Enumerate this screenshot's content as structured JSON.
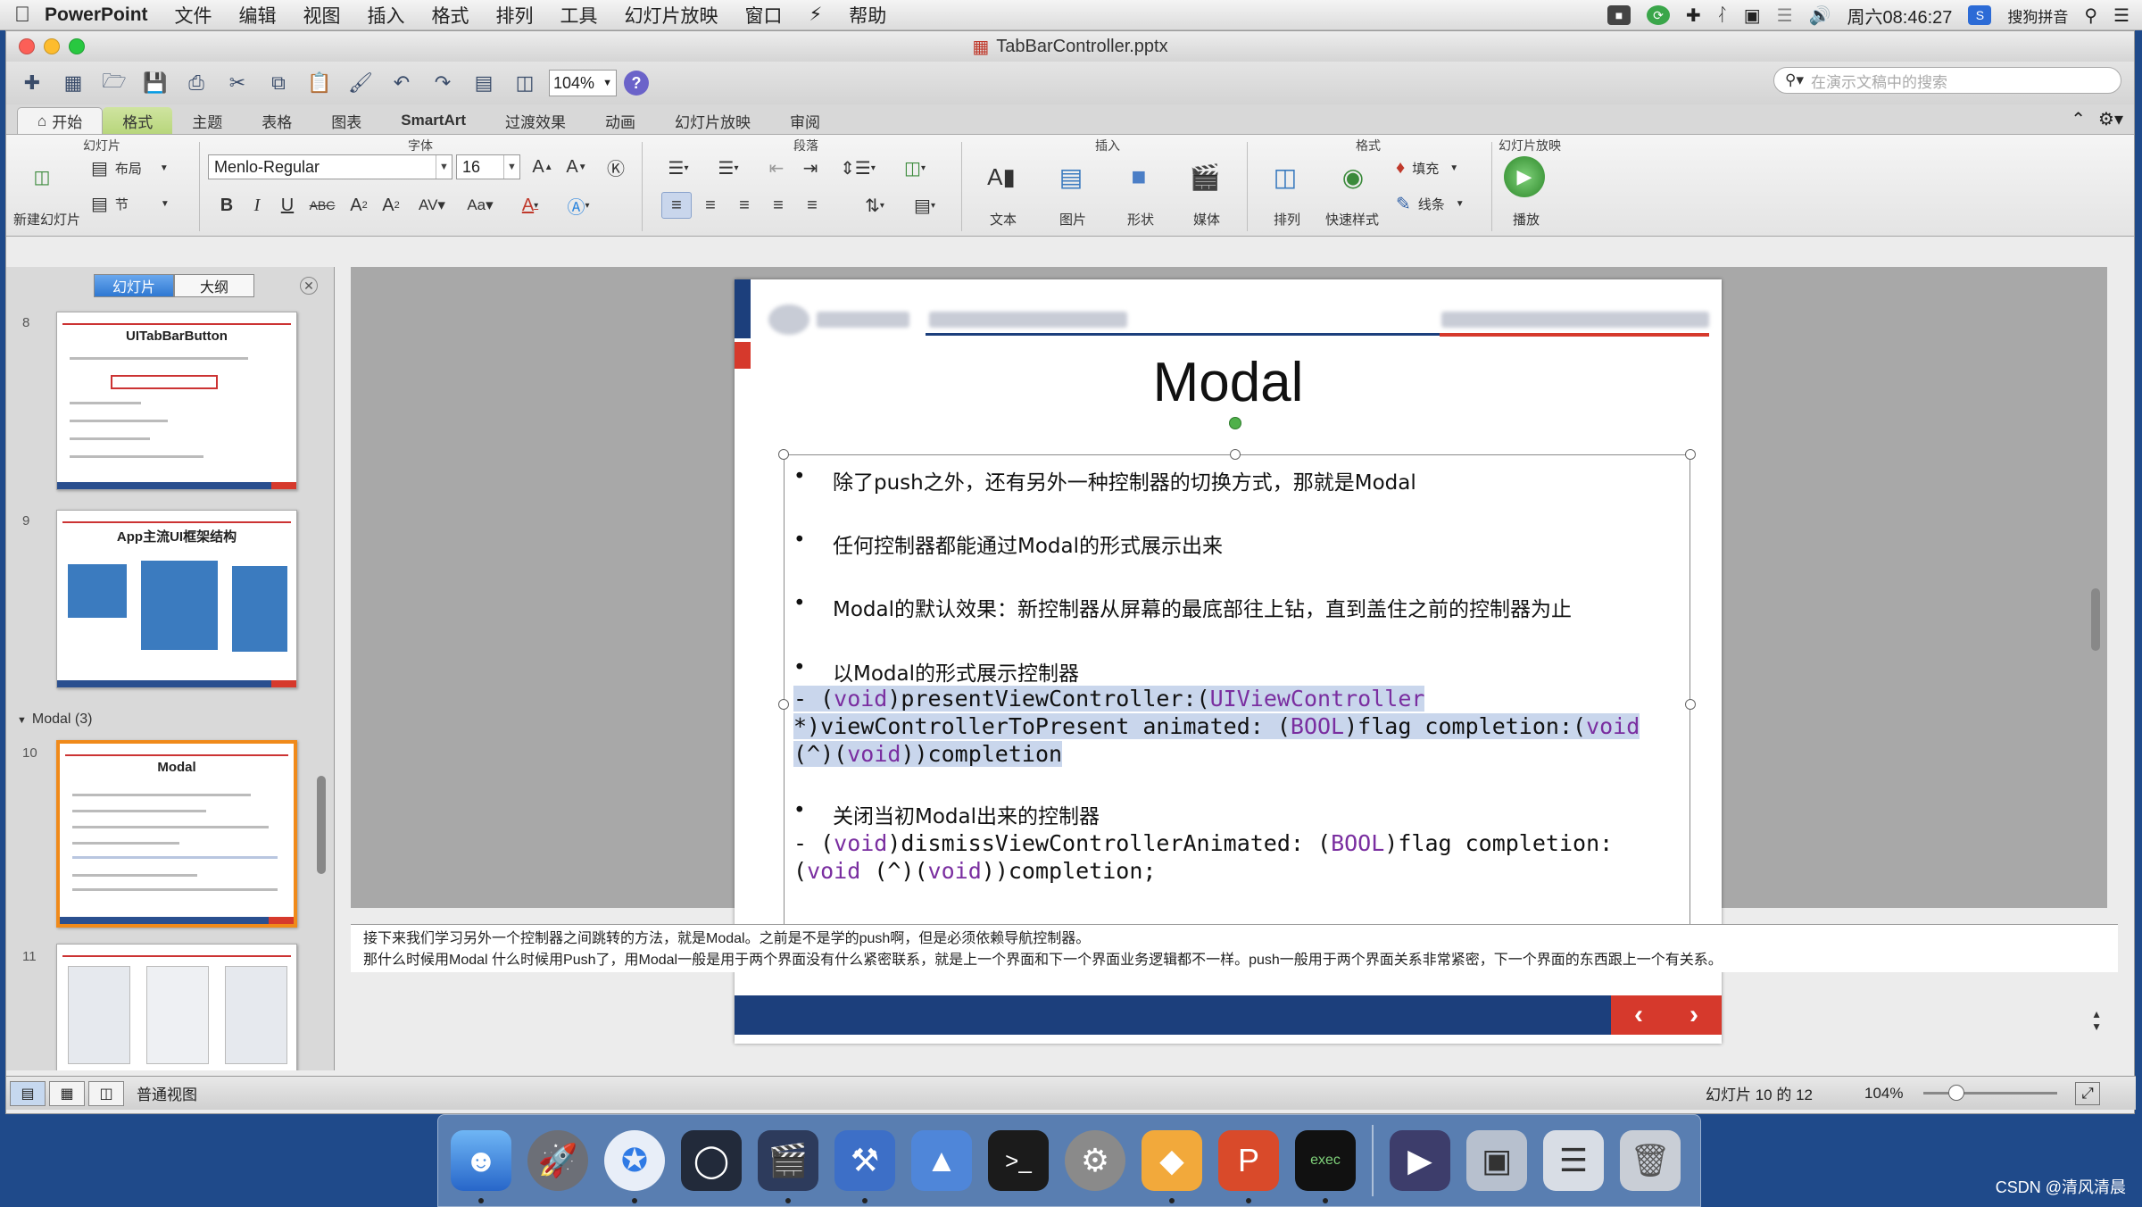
{
  "menubar": {
    "app_name": "PowerPoint",
    "items": [
      "文件",
      "编辑",
      "视图",
      "插入",
      "格式",
      "排列",
      "工具",
      "幻灯片放映",
      "窗口",
      "帮助"
    ],
    "clock": "周六08:46:27",
    "input_method": "搜狗拼音"
  },
  "window": {
    "title": "TabBarController.pptx",
    "zoom": "104%",
    "search_placeholder": "在演示文稿中的搜索"
  },
  "ribbon": {
    "tabs": [
      "开始",
      "格式",
      "主题",
      "表格",
      "图表",
      "SmartArt",
      "过渡效果",
      "动画",
      "幻灯片放映",
      "审阅"
    ],
    "groups": {
      "slides": "幻灯片",
      "font": "字体",
      "paragraph": "段落",
      "insert": "插入",
      "format": "格式",
      "slideshow": "幻灯片放映"
    },
    "labels": {
      "new_slide": "新建幻灯片",
      "layout": "布局",
      "section": "节",
      "font_name": "Menlo-Regular",
      "font_size": "16",
      "text": "文本",
      "picture": "图片",
      "shape": "形状",
      "media": "媒体",
      "arrange": "排列",
      "quick_styles": "快速样式",
      "fill": "填充",
      "line": "线条",
      "play": "播放"
    }
  },
  "panel": {
    "tab_slides": "幻灯片",
    "tab_outline": "大纲",
    "section_name": "Modal (3)",
    "thumbs": [
      {
        "num": "8",
        "title": "UITabBarButton"
      },
      {
        "num": "9",
        "title": "App主流UI框架结构"
      },
      {
        "num": "10",
        "title": "Modal"
      },
      {
        "num": "11",
        "title": ""
      }
    ]
  },
  "slide": {
    "title": "Modal",
    "bullets": [
      "除了push之外，还有另外一种控制器的切换方式，那就是Modal",
      "任何控制器都能通过Modal的形式展示出来",
      "Modal的默认效果：新控制器从屏幕的最底部往上钻，直到盖住之前的控制器为止",
      "以Modal的形式展示控制器",
      "关闭当初Modal出来的控制器"
    ],
    "nav_prev": "‹",
    "nav_next": "›"
  },
  "notes": {
    "line1": "接下来我们学习另外一个控制器之间跳转的方法，就是Modal。之前是不是学的push啊，但是必须依赖导航控制器。",
    "line2": "那什么时候用Modal 什么时候用Push了，用Modal一般是用于两个界面没有什么紧密联系，就是上一个界面和下一个界面业务逻辑都不一样。push一般用于两个界面关系非常紧密，下一个界面的东西跟上一个有关系。"
  },
  "status": {
    "view_name": "普通视图",
    "slide_count": "幻灯片 10 的 12",
    "zoom": "104%"
  },
  "watermark": "CSDN @清风清晨"
}
